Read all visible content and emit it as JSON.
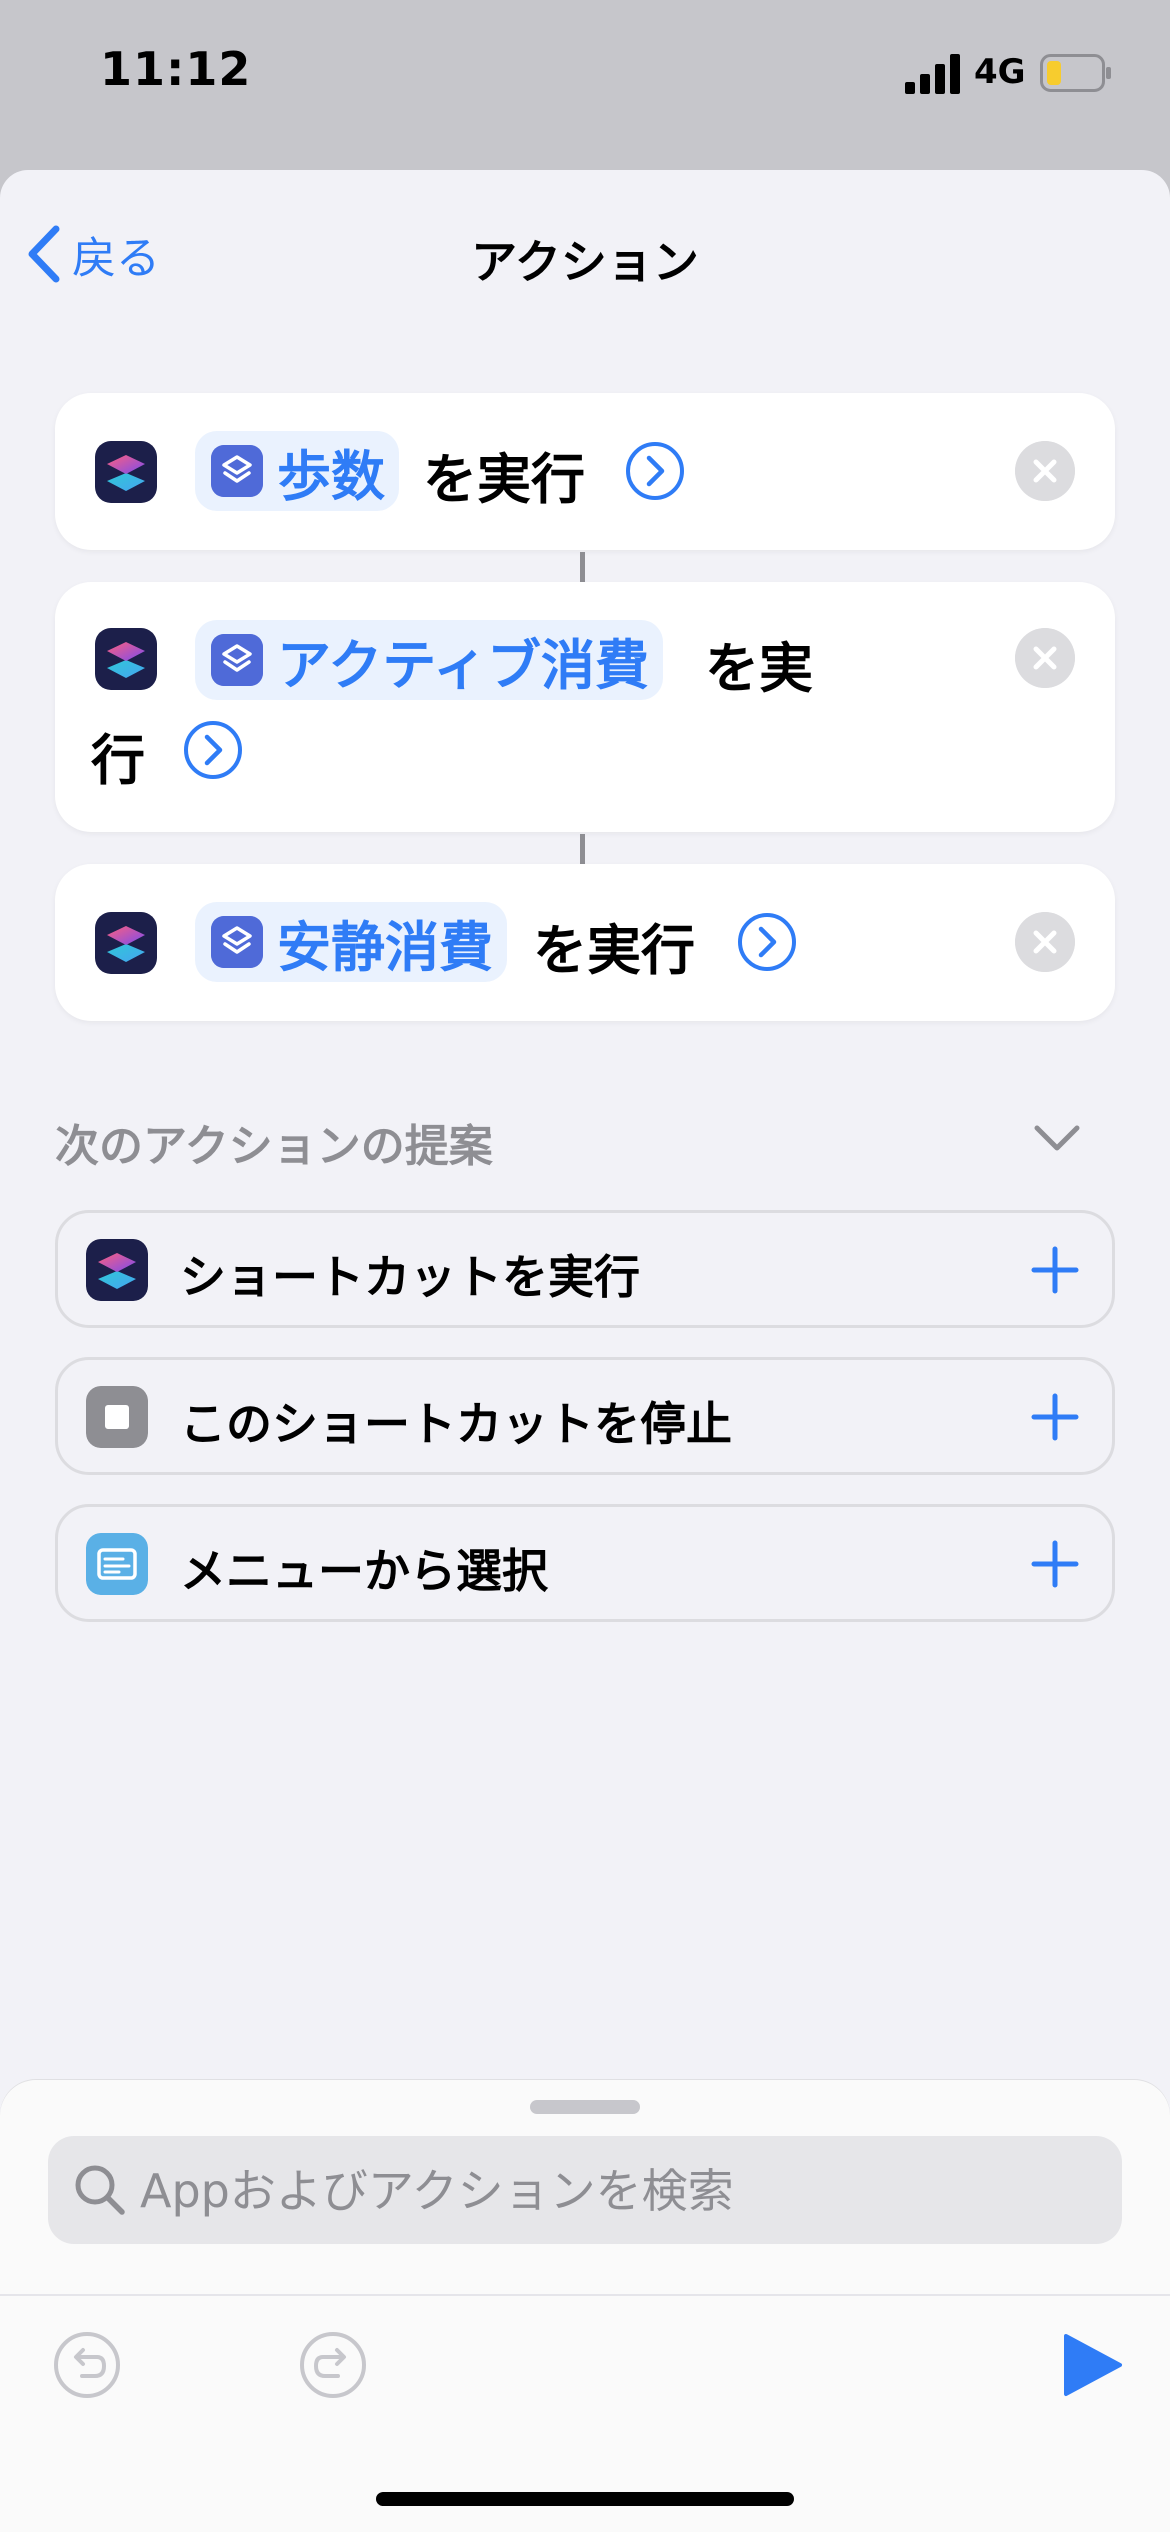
{
  "status_bar": {
    "time": "11:12",
    "network": "4G"
  },
  "nav": {
    "back_label": "戻る",
    "title": "アクション"
  },
  "actions": [
    {
      "pill_label": "歩数",
      "suffix": "を実行"
    },
    {
      "pill_label": "アクティブ消費",
      "suffix_line1": "を実",
      "suffix_line2": "行"
    },
    {
      "pill_label": "安静消費",
      "suffix": "を実行"
    }
  ],
  "suggestions": {
    "title": "次のアクションの提案",
    "items": [
      {
        "label": "ショートカットを実行",
        "icon": "shortcuts-app-icon"
      },
      {
        "label": "このショートカットを停止",
        "icon": "stop-icon"
      },
      {
        "label": "メニューから選択",
        "icon": "menu-icon"
      }
    ]
  },
  "search": {
    "placeholder": "Appおよびアクションを検索"
  },
  "colors": {
    "accent": "#2f7cf6",
    "sheet_bg": "#f2f2f7",
    "pill_bg": "#eaf2fe"
  }
}
